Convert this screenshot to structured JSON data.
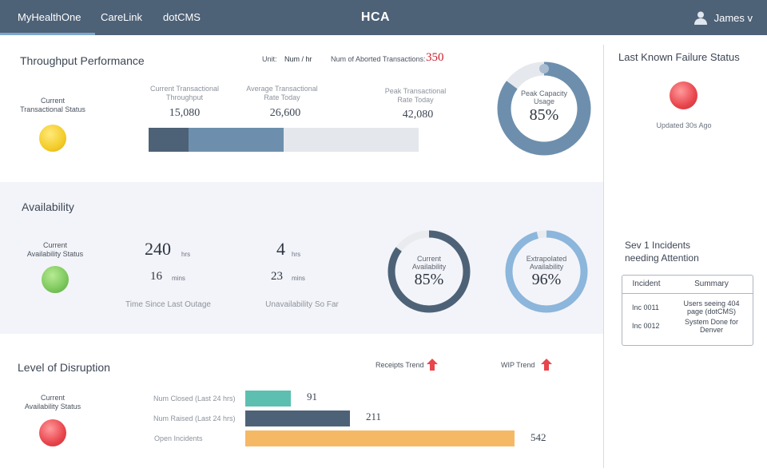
{
  "nav": {
    "tabs": [
      {
        "label": "MyHealthOne",
        "active": true
      },
      {
        "label": "CareLink",
        "active": false
      },
      {
        "label": "dotCMS",
        "active": false
      }
    ],
    "brand": "HCA",
    "user": "James  v"
  },
  "throughput": {
    "title": "Throughput Performance",
    "unit_label": "Unit:",
    "unit_value": "Num / hr",
    "aborted_label": "Num of Aborted Transactions:",
    "aborted_value": "350",
    "status_label": "Current\nTransactional Status",
    "metrics": [
      {
        "label": "Current Transactional\nThroughput",
        "value": "15,080"
      },
      {
        "label": "Average Transactional\nRate Today",
        "value": "26,600"
      },
      {
        "label": "Peak Transactional\nRate Today",
        "value": "42,080"
      }
    ],
    "peak_capacity": {
      "label": "Peak Capacity\nUsage",
      "value": "85%",
      "fraction": 0.85
    }
  },
  "availability": {
    "title": "Availability",
    "status_label": "Current\nAvailability Status",
    "since_outage": {
      "hrs": "240",
      "hrs_unit": "hrs",
      "mins": "16",
      "mins_unit": "mins",
      "caption": "Time Since  Last Outage"
    },
    "unavailability": {
      "hrs": "4",
      "hrs_unit": "hrs",
      "mins": "23",
      "mins_unit": "mins",
      "caption": "Unavailability So Far"
    },
    "current": {
      "label": "Current\nAvailability",
      "value": "85%",
      "fraction": 0.85
    },
    "extrapolated": {
      "label": "Extrapolated\nAvailability",
      "value": "96%",
      "fraction": 0.96
    }
  },
  "disruption": {
    "title": "Level of Disruption",
    "status_label": "Current\nAvailability Status",
    "receipts_trend": "Receipts Trend",
    "wip_trend": "WIP Trend",
    "bars": [
      {
        "label": "Num Closed (Last 24 hrs)",
        "value": "91",
        "color": "#5dbfb0"
      },
      {
        "label": "Num Raised (Last 24 hrs)",
        "value": "211",
        "color": "#4e6277"
      },
      {
        "label": "Open Incidents",
        "value": "542",
        "color": "#f5b965"
      }
    ]
  },
  "failure": {
    "title": "Last Known Failure Status",
    "updated": "Updated 30s Ago"
  },
  "sev1": {
    "title": "Sev 1 Incidents\nneeding Attention",
    "headers": [
      "Incident",
      "Summary"
    ],
    "rows": [
      {
        "incident": "Inc 0011",
        "summary": "Users seeing 404\npage (dotCMS)"
      },
      {
        "incident": "Inc 0012",
        "summary": "System Done for\nDenver"
      }
    ]
  },
  "colors": {
    "nav": "#4d6177",
    "accent_blue": "#6d8fad",
    "aborted_red": "#c8202a",
    "status_yellow": "#f3cc2a",
    "status_green": "#7cc75c",
    "status_red": "#e8454c"
  }
}
